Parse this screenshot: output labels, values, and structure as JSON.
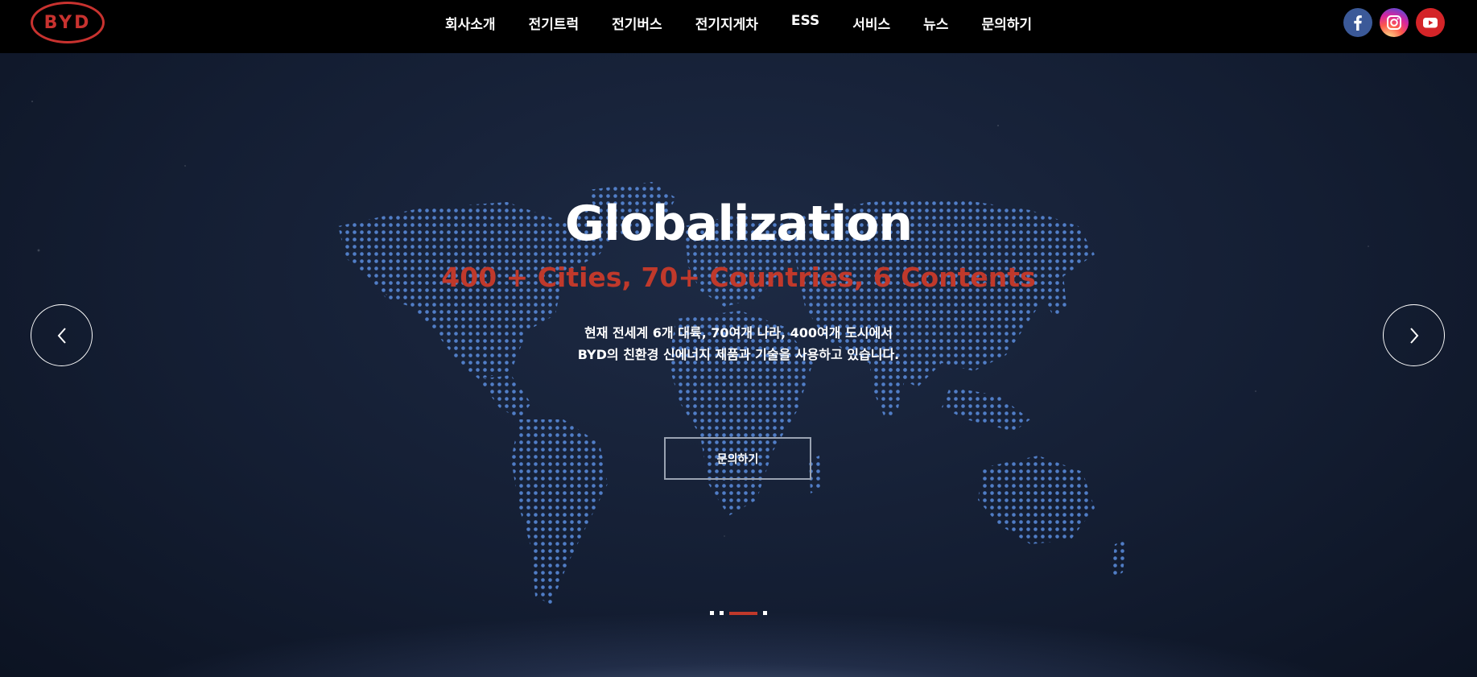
{
  "header": {
    "logo_text": "BYD",
    "nav": [
      {
        "label": "회사소개"
      },
      {
        "label": "전기트럭"
      },
      {
        "label": "전기버스"
      },
      {
        "label": "전기지게차"
      },
      {
        "label": "ESS"
      },
      {
        "label": "서비스"
      },
      {
        "label": "뉴스"
      },
      {
        "label": "문의하기"
      }
    ],
    "social": [
      {
        "icon": "facebook-icon",
        "color": "#3b5998"
      },
      {
        "icon": "instagram-icon",
        "color": "#d6249f"
      },
      {
        "icon": "youtube-icon",
        "color": "#d42428"
      }
    ]
  },
  "hero": {
    "title": "Globalization",
    "subtitle": "400 + Cities, 70+ Countries, 6 Contents",
    "description_line1": "현재 전세계 6개 대륙, 70여개 나라, 400여개 도시에서",
    "description_line2": "BYD의 친환경 신에너지 제품과 기술을 사용하고 있습니다.",
    "cta_label": "문의하기",
    "prev_icon": "chevron-left-icon",
    "next_icon": "chevron-right-icon",
    "pagination": {
      "total": 4,
      "active_index": 2
    }
  },
  "colors": {
    "brand_red": "#c8322f",
    "subtitle_red": "#c0392b",
    "map_dot": "#5b8ee0",
    "background": "#141e33"
  }
}
